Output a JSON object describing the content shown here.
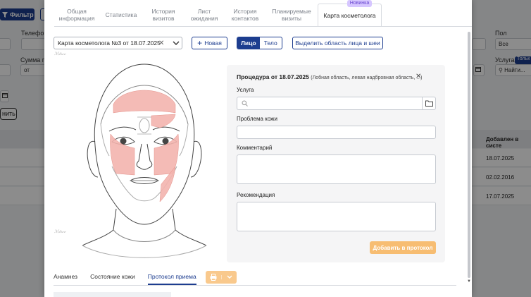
{
  "background": {
    "filter_label": "Фильтр",
    "labels": {
      "phone": "Телефон",
      "sum": "Сумма п",
      "sex": "Пол",
      "service": "Услуга",
      "only": "Тольк"
    },
    "sum_from": "от",
    "sex_value": "Все",
    "service_placeholder": "Найти...",
    "apply_fragment": "нить",
    "added_header": "Добавлен в систе",
    "dates": [
      "18.07.2025",
      "02.02.2016",
      "17.07.2025"
    ]
  },
  "modal": {
    "tab_badge": "Новинка",
    "tabs": [
      {
        "label": "Общая\nинформация"
      },
      {
        "label": "Статистика"
      },
      {
        "label": "История\nвизитов"
      },
      {
        "label": "Лист\nожидания"
      },
      {
        "label": "История\nконтактов"
      },
      {
        "label": "Планируемые\nвизиты"
      },
      {
        "label": "Карта косметолога"
      }
    ],
    "card_select": "Карта косметолога №3 от 18.07.2025",
    "new_button": "Новая",
    "face_label": "Лицо",
    "body_label": "Тело",
    "zone_button": "Выделить область лица и шеи",
    "procedure_title": "Процедура от 18.07.2025",
    "procedure_zones": "(Лобная область, левая надбровная область, ...)",
    "fields": {
      "service": "Услуга",
      "problem": "Проблема кожи",
      "comment": "Комментарий",
      "recommendation": "Рекомендация"
    },
    "add_button": "Добавить в протокол",
    "bottom_tabs": [
      "Анамнез",
      "Состояние кожи",
      "Протокол приема"
    ]
  },
  "colors": {
    "primary": "#1d3d8f",
    "highlight_zone": "#f3b4ae",
    "add_button": "#f7bd72"
  }
}
